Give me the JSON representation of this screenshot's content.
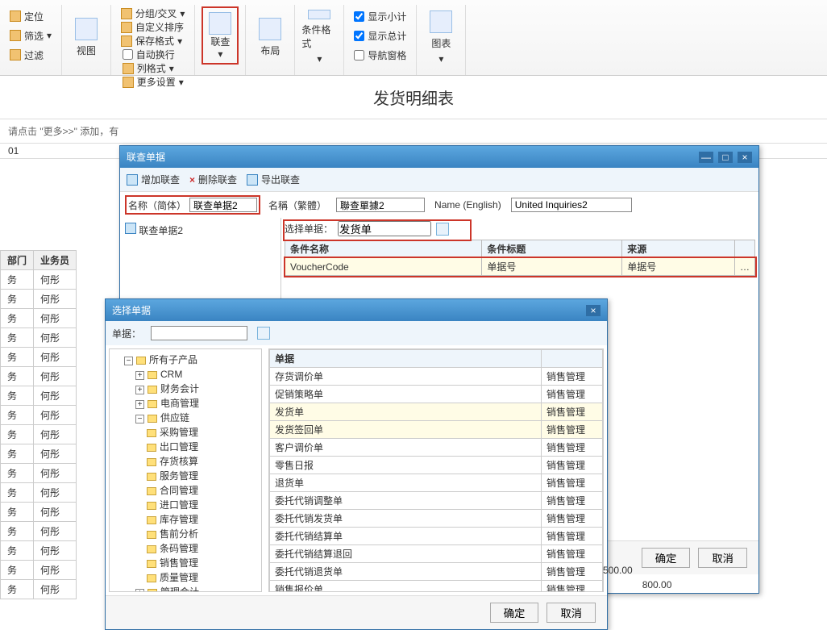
{
  "page_title": "发货明细表",
  "ribbon": {
    "dingwei": "定位",
    "shaixuan": "筛选",
    "guolv": "过滤",
    "shitu": "视图",
    "fenzu": "分组/交叉",
    "zidingyi": "自定义排序",
    "baocun": "保存格式",
    "zidonghuanhang": "自动换行",
    "liegesi": "列格式",
    "gengduo": "更多设置",
    "lianzha": "联查",
    "buju": "布局",
    "tiaojian": "条件格式",
    "xiaoji": "显示小计",
    "zongji": "显示总计",
    "daohang": "导航窗格",
    "tubiao": "图表"
  },
  "hint": "请点击 \"更多>>\" 添加，有",
  "num": "01",
  "bg_table": {
    "headers": [
      "部门",
      "业务员"
    ],
    "dept": "务",
    "name": "何彤"
  },
  "dlg1": {
    "title": "联查单据",
    "tb_add": "增加联查",
    "tb_del": "删除联查",
    "tb_exp": "导出联查",
    "lbl_name_s": "名称（简体）",
    "val_name_s": "联查单据2",
    "lbl_name_t": "名稱（繁體）",
    "val_name_t": "聯查單據2",
    "lbl_name_e": "Name (English)",
    "val_name_e": "United Inquiries2",
    "tree_root": "联查单据2",
    "sel_lbl": "选择单据：",
    "sel_val": "发货单",
    "cond_h1": "条件名称",
    "cond_h2": "条件标题",
    "cond_h3": "来源",
    "cond_v1": "VoucherCode",
    "cond_v2": "单据号",
    "cond_v3": "单据号",
    "ok": "确定",
    "cancel": "取消"
  },
  "dlg2": {
    "title": "选择单据",
    "lbl": "单据：",
    "tree_root": "所有子产品",
    "tree": [
      "CRM",
      "财务会计",
      "电商管理"
    ],
    "gyl": "供应链",
    "gyl_children": [
      "采购管理",
      "出口管理",
      "存货核算",
      "服务管理",
      "合同管理",
      "进口管理",
      "库存管理",
      "售前分析",
      "条码管理",
      "销售管理",
      "质量管理"
    ],
    "last": "管理会计",
    "col1": "单据",
    "col2_val": "销售管理",
    "rows": [
      "存货调价单",
      "促销策略单",
      "发货单",
      "发货签回单",
      "客户调价单",
      "零售日报",
      "退货单",
      "委托代销调整单",
      "委托代销发货单",
      "委托代销结算单",
      "委托代销结算退回",
      "委托代销退货单",
      "销售报价单"
    ],
    "ok": "确定",
    "cancel": "取消"
  },
  "savebar": {
    "v1": "500.00",
    "v2": "800.00"
  }
}
